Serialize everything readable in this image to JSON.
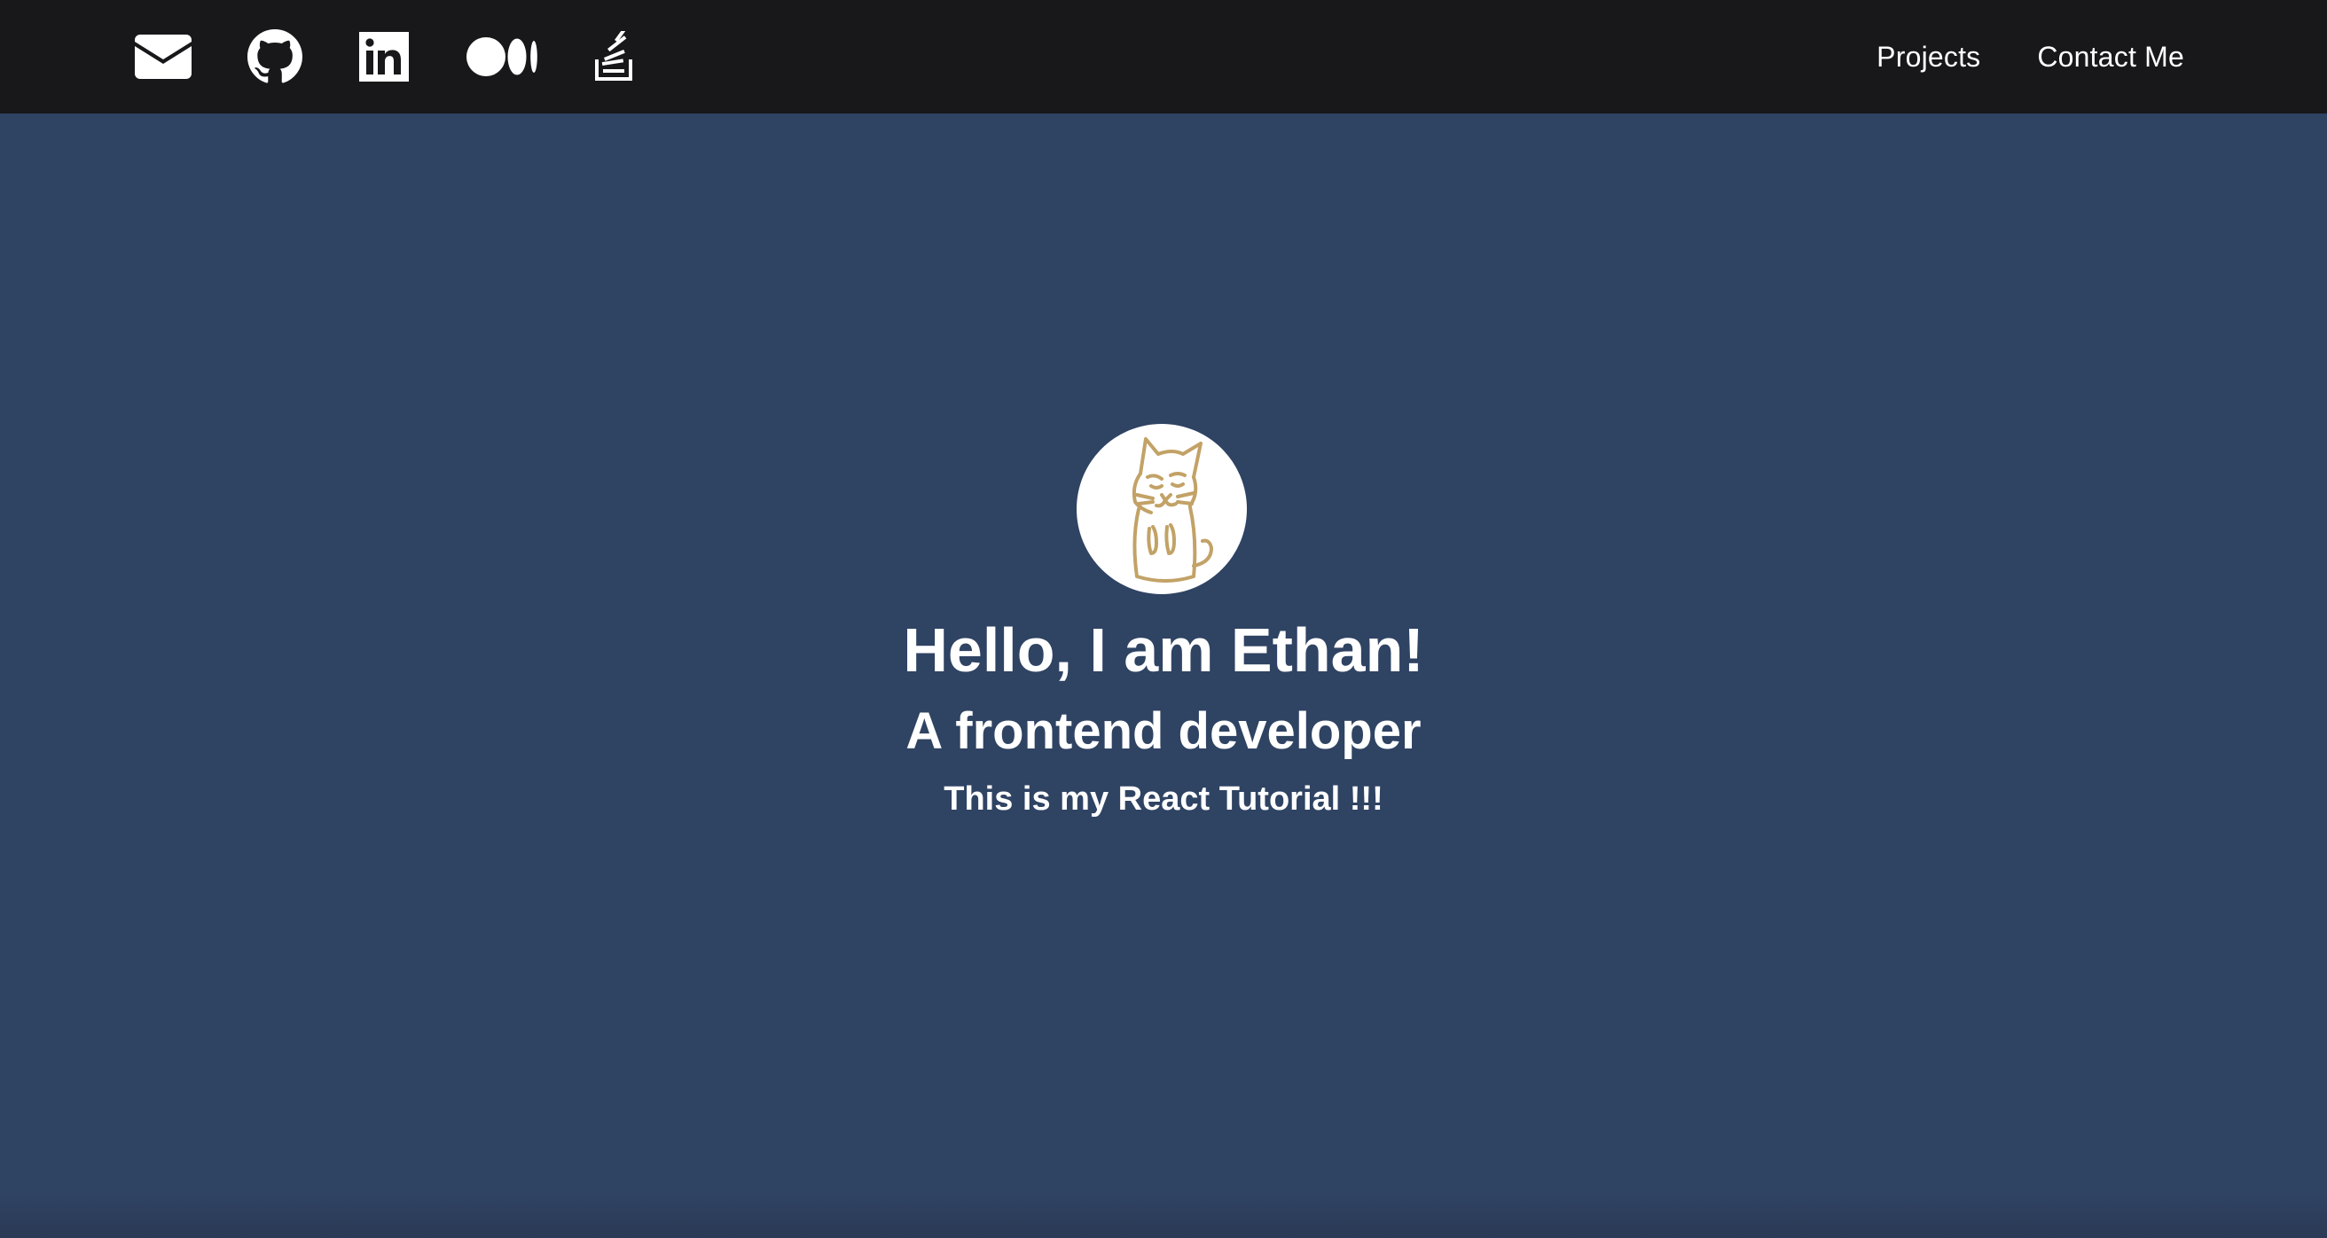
{
  "nav": {
    "social_icons": [
      {
        "name": "envelope-icon",
        "label": "Email"
      },
      {
        "name": "github-icon",
        "label": "GitHub"
      },
      {
        "name": "linkedin-icon",
        "label": "LinkedIn"
      },
      {
        "name": "medium-icon",
        "label": "Medium"
      },
      {
        "name": "stack-overflow-icon",
        "label": "Stack Overflow"
      }
    ],
    "links": {
      "projects": "Projects",
      "contact": "Contact Me"
    }
  },
  "hero": {
    "avatar": "cat-illustration",
    "greeting": "Hello, I am Ethan!",
    "role": "A frontend developer",
    "tagline": "This is my React Tutorial !!!"
  },
  "colors": {
    "navbar_bg": "#18181b",
    "hero_bg": "#2f4363",
    "text": "#ffffff",
    "avatar_line": "#c2a266"
  }
}
